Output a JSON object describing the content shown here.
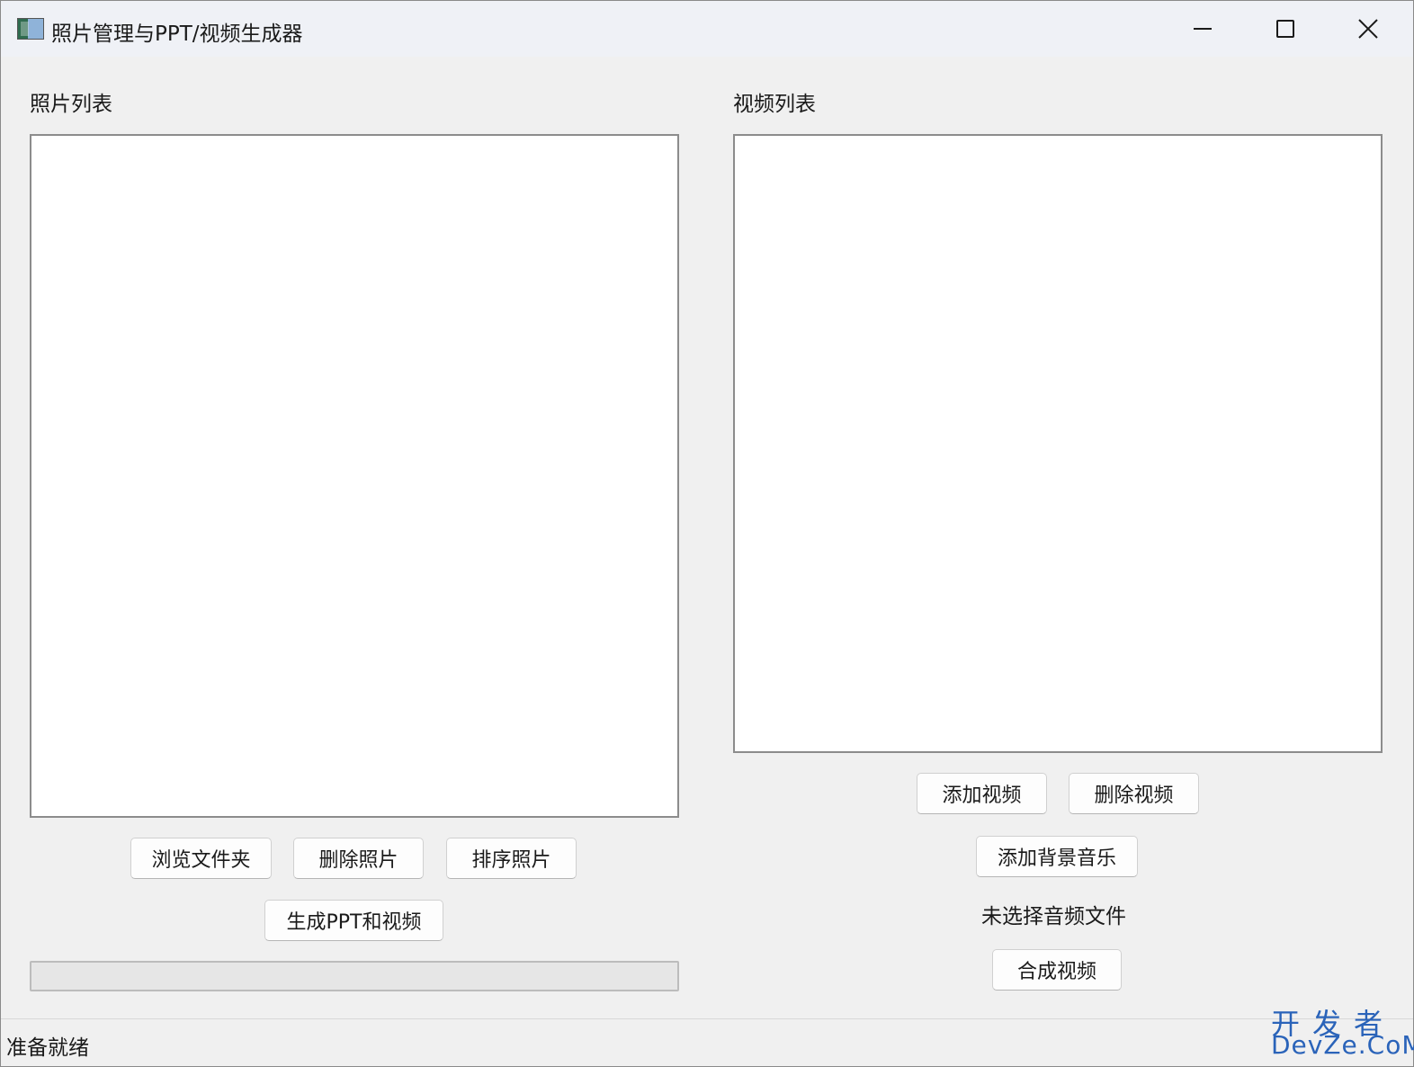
{
  "window": {
    "title": "照片管理与PPT/视频生成器",
    "icon": "app-window-icon",
    "controls": [
      "minimize-icon",
      "maximize-icon",
      "close-icon"
    ]
  },
  "photos": {
    "label": "照片列表",
    "items": [],
    "buttons": {
      "browse": "浏览文件夹",
      "delete": "删除照片",
      "sort": "排序照片",
      "generate": "生成PPT和视频"
    },
    "progress": 0
  },
  "videos": {
    "label": "视频列表",
    "items": [],
    "buttons": {
      "add": "添加视频",
      "delete": "删除视频",
      "add_music": "添加背景音乐",
      "merge": "合成视频"
    },
    "audio_status": "未选择音频文件"
  },
  "status_bar": {
    "text": "准备就绪"
  },
  "watermark": {
    "line1": "开发者",
    "line2": "DevZe.CoM"
  },
  "colors": {
    "progress_fill": "#06b025",
    "watermark": "#2a63b9"
  }
}
